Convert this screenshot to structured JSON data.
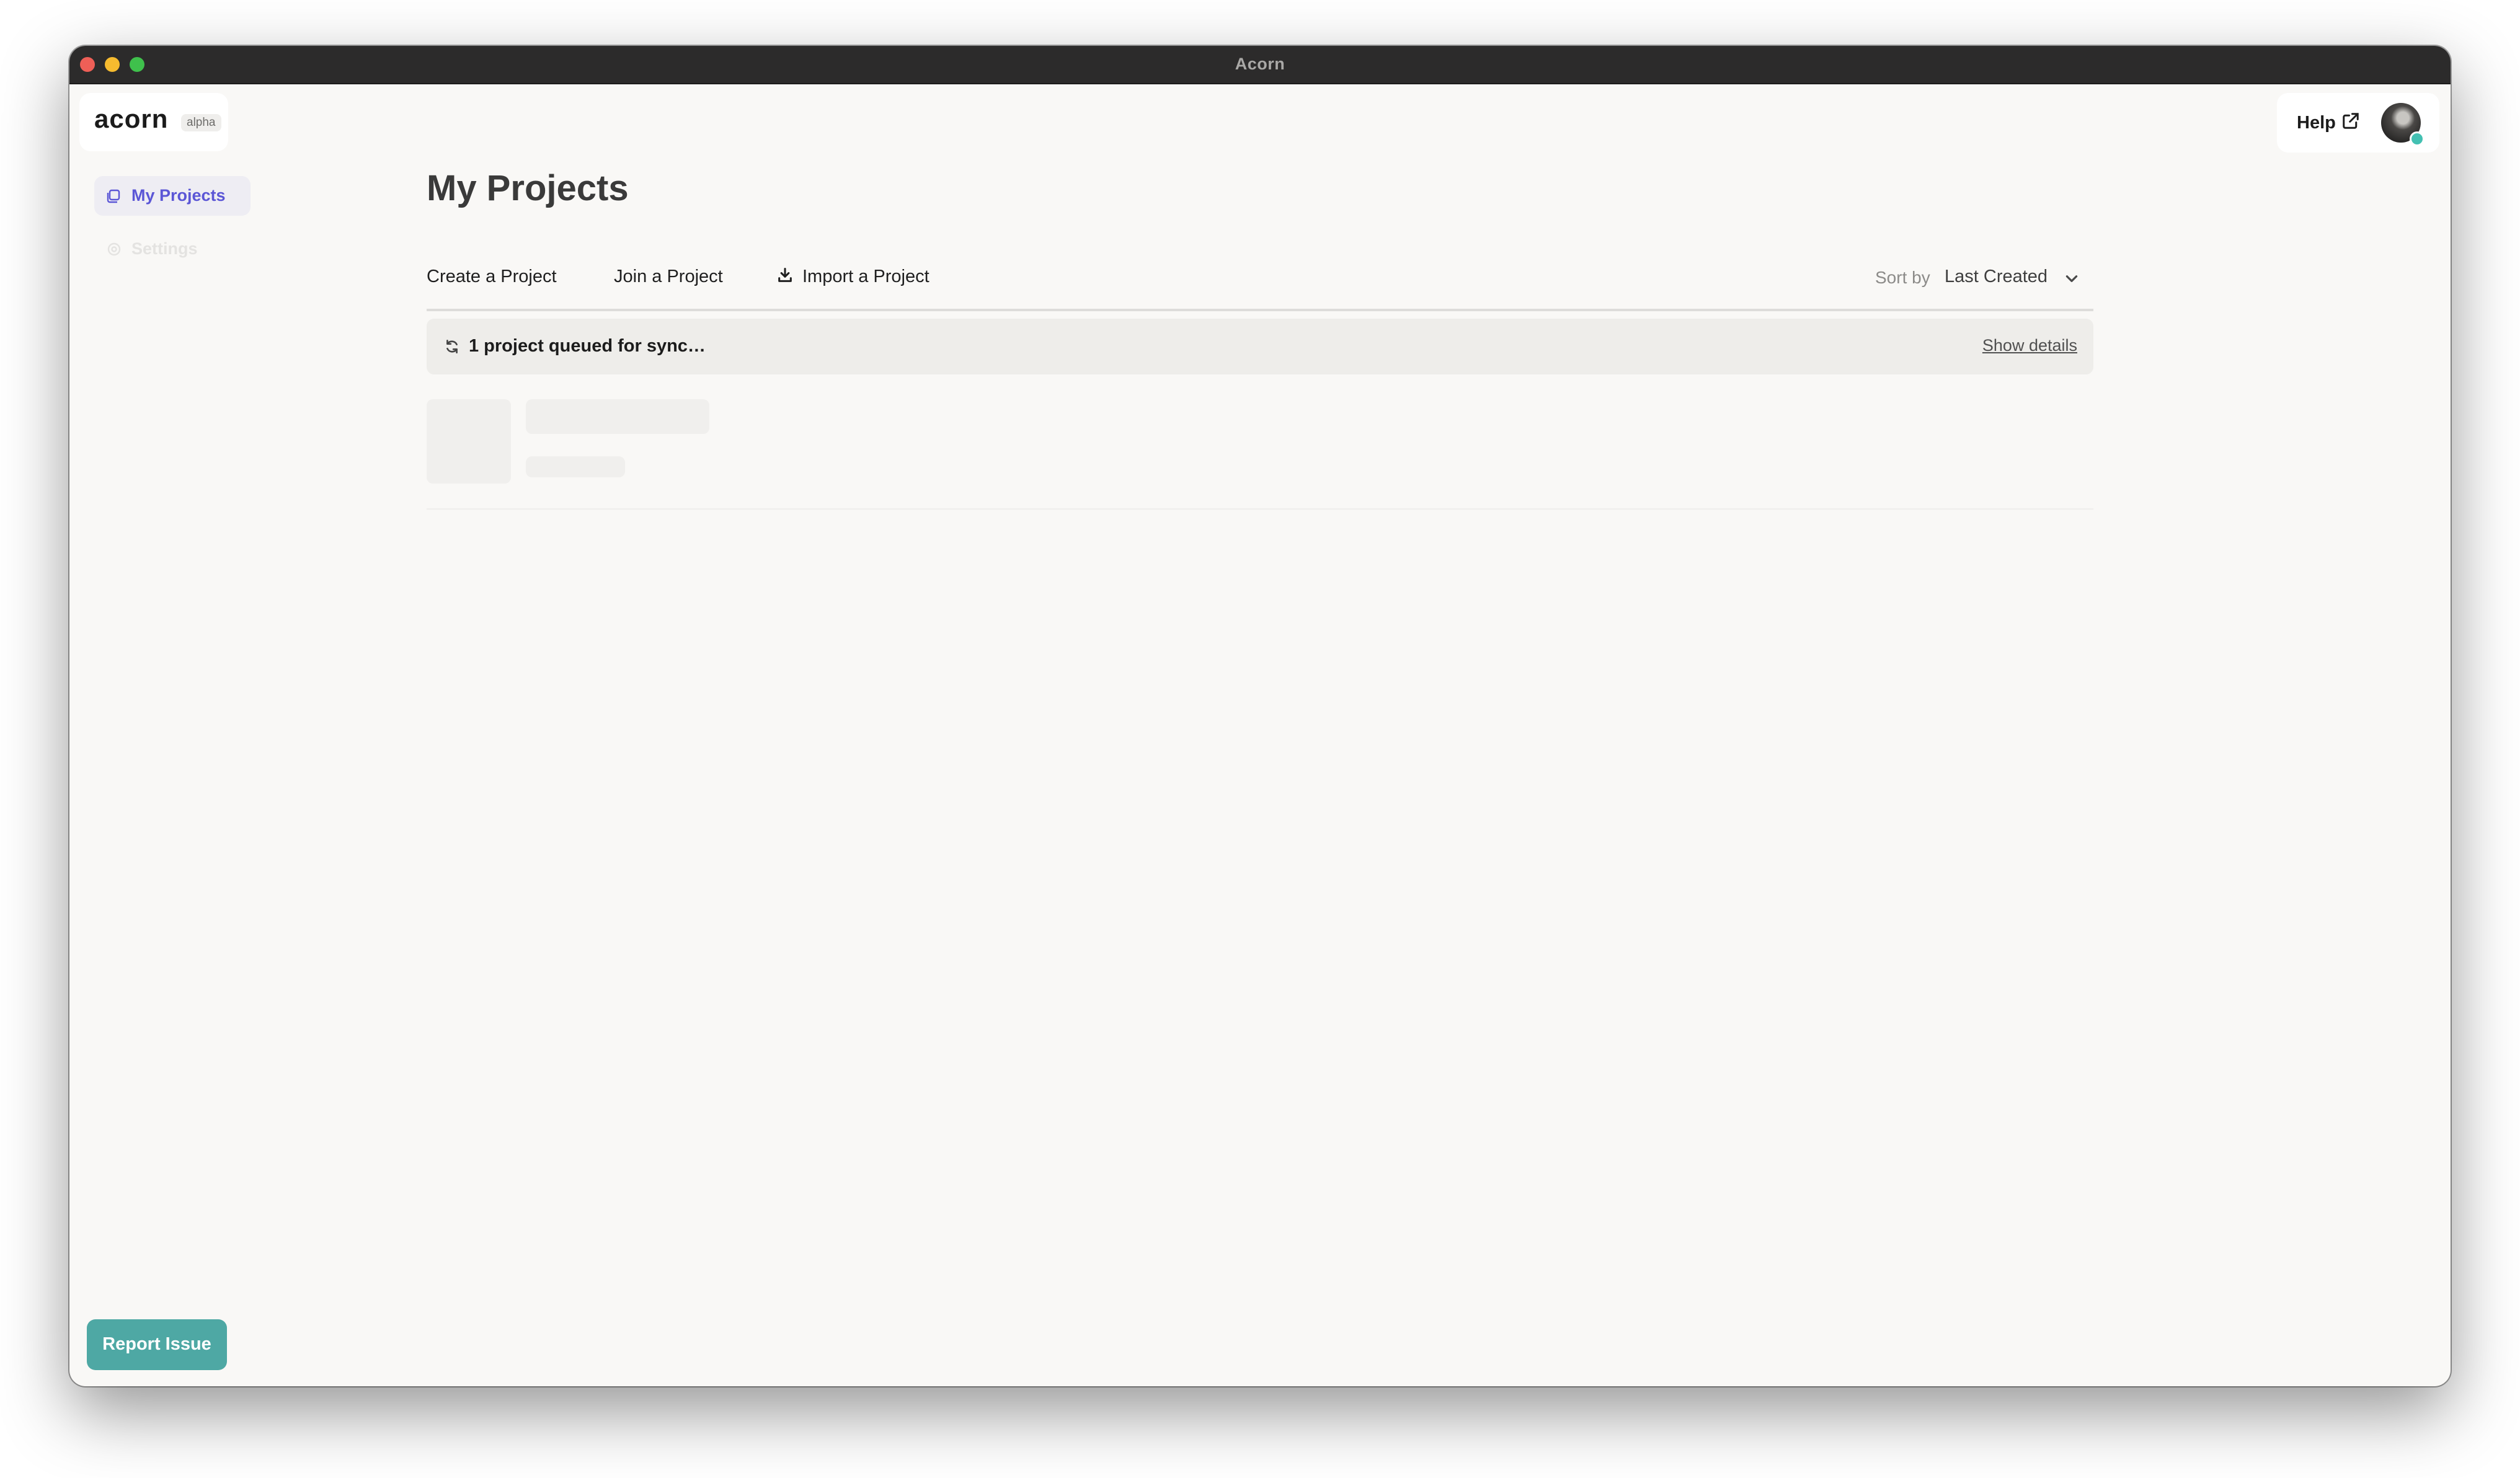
{
  "window": {
    "title": "Acorn"
  },
  "brand": {
    "name": "acorn",
    "badge": "alpha"
  },
  "sidebar": {
    "items": [
      {
        "label": "My Projects",
        "icon": "projects-icon",
        "active": true
      },
      {
        "label": "Settings",
        "icon": "gear-icon",
        "active": false
      }
    ]
  },
  "header": {
    "help_label": "Help"
  },
  "main": {
    "title": "My Projects",
    "actions": {
      "create": "Create a Project",
      "join": "Join a Project",
      "import": "Import a Project"
    },
    "sort": {
      "label": "Sort by",
      "value": "Last Created"
    },
    "sync": {
      "message": "1 project queued for sync…",
      "details_link": "Show details"
    }
  },
  "footer": {
    "report_label": "Report Issue"
  },
  "colors": {
    "accent": "#5b56d6",
    "report_button": "#4ea8a4",
    "status_dot": "#43c0b2",
    "titlebar": "#2c2b2b"
  }
}
